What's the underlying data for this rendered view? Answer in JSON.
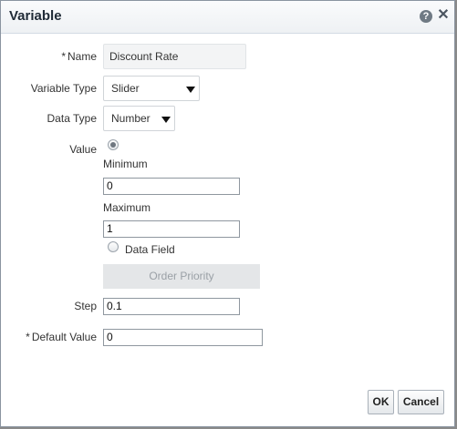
{
  "dialog": {
    "title": "Variable",
    "help_icon": "help-icon",
    "help_glyph": "?",
    "close_icon": "close-icon",
    "close_glyph": "✕"
  },
  "form": {
    "required_marker": "*",
    "name": {
      "label": "Name",
      "value": "Discount Rate"
    },
    "variable_type": {
      "label": "Variable Type",
      "value": "Slider"
    },
    "data_type": {
      "label": "Data Type",
      "value": "Number"
    },
    "value": {
      "label": "Value",
      "minimum_label": "Minimum",
      "minimum_value": "0",
      "maximum_label": "Maximum",
      "maximum_value": "1",
      "data_field_label": "Data Field",
      "data_field_value": "Order Priority"
    },
    "step": {
      "label": "Step",
      "value": "0.1"
    },
    "default_value": {
      "label": "Default Value",
      "value": "0"
    }
  },
  "buttons": {
    "ok": "OK",
    "cancel": "Cancel"
  },
  "colors": {
    "titlebar": "#eef1f4",
    "disabled_field": "#e4e6e8",
    "backdrop": "#8a8a8a"
  }
}
